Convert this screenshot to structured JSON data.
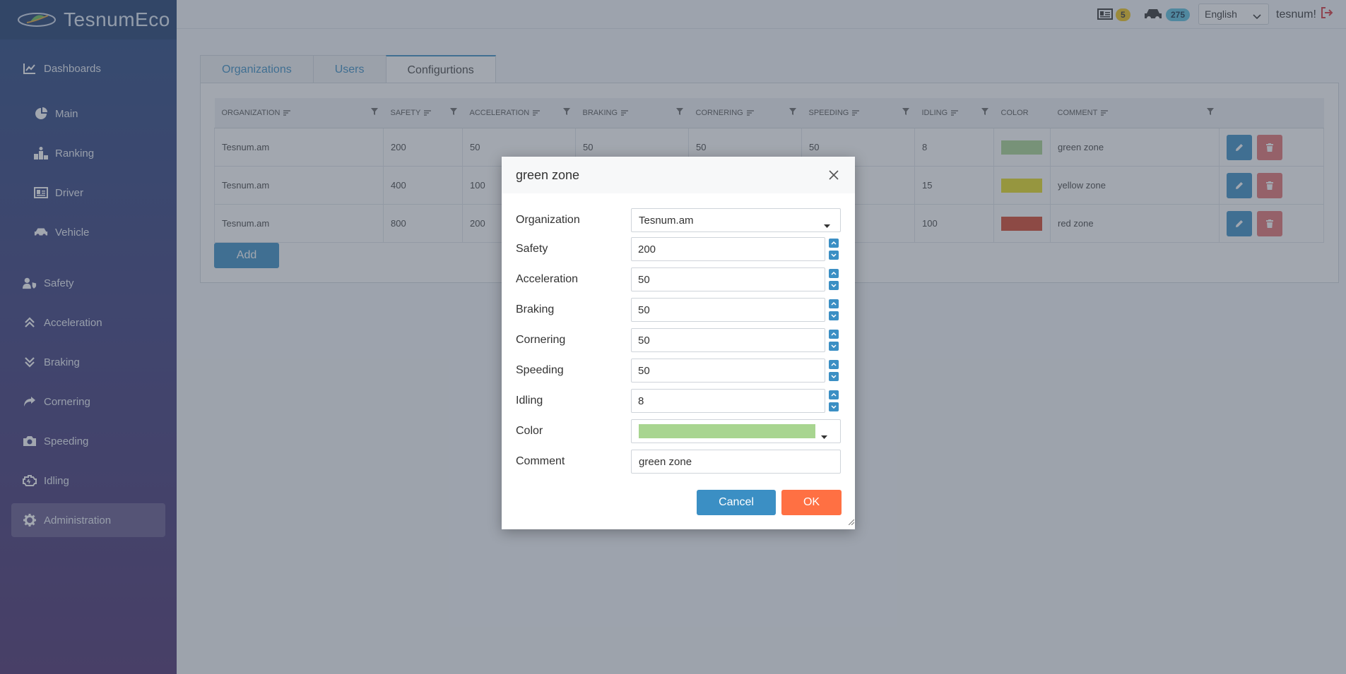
{
  "app": {
    "title": "TesnumEco"
  },
  "sidebar": {
    "items": [
      {
        "label": "Dashboards",
        "icon": "chart-line-icon"
      },
      {
        "label": "Main",
        "icon": "pie-chart-icon"
      },
      {
        "label": "Ranking",
        "icon": "podium-icon"
      },
      {
        "label": "Driver",
        "icon": "id-card-icon"
      },
      {
        "label": "Vehicle",
        "icon": "car-icon"
      },
      {
        "label": "Safety",
        "icon": "user-shield-icon"
      },
      {
        "label": "Acceleration",
        "icon": "double-chevron-up-icon"
      },
      {
        "label": "Braking",
        "icon": "double-chevron-down-icon"
      },
      {
        "label": "Cornering",
        "icon": "share-arrow-icon"
      },
      {
        "label": "Speeding",
        "icon": "camera-icon"
      },
      {
        "label": "Idling",
        "icon": "engine-icon"
      },
      {
        "label": "Administration",
        "icon": "gear-icon"
      }
    ]
  },
  "header": {
    "driver_count": "5",
    "vehicle_count": "275",
    "language": "English",
    "username": "tesnum!"
  },
  "tabs": [
    "Organizations",
    "Users",
    "Configurtions"
  ],
  "table": {
    "columns": [
      "ORGANIZATION",
      "SAFETY",
      "ACCELERATION",
      "BRAKING",
      "CORNERING",
      "SPEEDING",
      "IDLING",
      "COLOR",
      "COMMENT"
    ],
    "rows": [
      {
        "organization": "Tesnum.am",
        "safety": "200",
        "acceleration": "50",
        "braking": "50",
        "cornering": "50",
        "speeding": "50",
        "idling": "8",
        "color": "#a8d590",
        "comment": "green zone"
      },
      {
        "organization": "Tesnum.am",
        "safety": "400",
        "acceleration": "100",
        "braking": "",
        "cornering": "",
        "speeding": "",
        "idling": "15",
        "color": "#e6dc1e",
        "comment": "yellow zone"
      },
      {
        "organization": "Tesnum.am",
        "safety": "800",
        "acceleration": "200",
        "braking": "",
        "cornering": "",
        "speeding": "",
        "idling": "100",
        "color": "#d5452a",
        "comment": "red zone"
      }
    ],
    "add_label": "Add"
  },
  "dialog": {
    "title": "green zone",
    "fields": {
      "organization": {
        "label": "Organization",
        "value": "Tesnum.am"
      },
      "safety": {
        "label": "Safety",
        "value": "200"
      },
      "acceleration": {
        "label": "Acceleration",
        "value": "50"
      },
      "braking": {
        "label": "Braking",
        "value": "50"
      },
      "cornering": {
        "label": "Cornering",
        "value": "50"
      },
      "speeding": {
        "label": "Speeding",
        "value": "50"
      },
      "idling": {
        "label": "Idling",
        "value": "8"
      },
      "color": {
        "label": "Color",
        "value": "#a8d590"
      },
      "comment": {
        "label": "Comment",
        "value": "green zone"
      }
    },
    "cancel_label": "Cancel",
    "ok_label": "OK"
  },
  "colors": {
    "accent": "#3b8fc4",
    "ok": "#ff7043",
    "delete": "#e57373"
  }
}
